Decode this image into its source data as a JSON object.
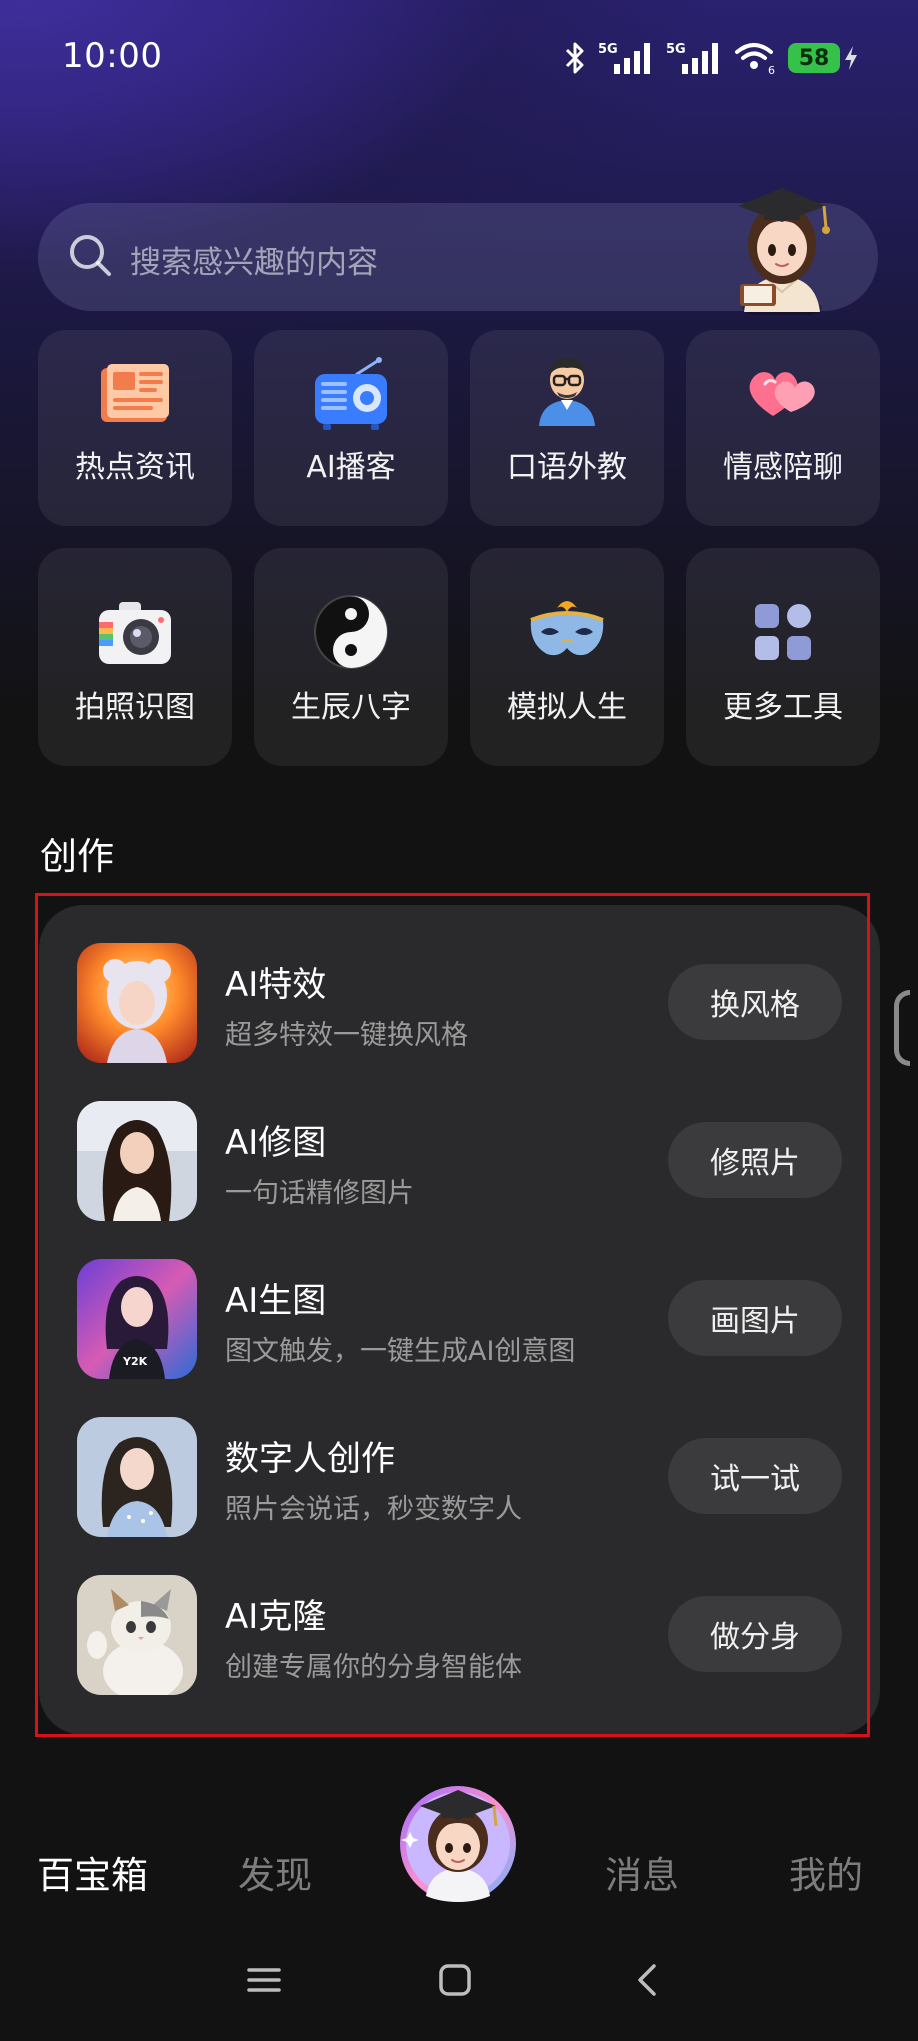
{
  "status_bar": {
    "time": "10:00",
    "network_1": "5G",
    "network_2": "5G",
    "wifi_badge": "6",
    "battery": "58"
  },
  "search": {
    "placeholder": "搜索感兴趣的内容"
  },
  "tools": [
    {
      "label": "热点资讯",
      "icon": "newspaper-icon"
    },
    {
      "label": "AI播客",
      "icon": "radio-icon"
    },
    {
      "label": "口语外教",
      "icon": "teacher-icon"
    },
    {
      "label": "情感陪聊",
      "icon": "hearts-icon"
    },
    {
      "label": "拍照识图",
      "icon": "camera-icon"
    },
    {
      "label": "生辰八字",
      "icon": "yin-yang-icon"
    },
    {
      "label": "模拟人生",
      "icon": "mask-icon"
    },
    {
      "label": "更多工具",
      "icon": "grid-icon"
    }
  ],
  "section": {
    "title": "创作"
  },
  "create_items": [
    {
      "title": "AI特效",
      "desc": "超多特效一键换风格",
      "button": "换风格"
    },
    {
      "title": "AI修图",
      "desc": "一句话精修图片",
      "button": "修照片"
    },
    {
      "title": "AI生图",
      "desc": "图文触发，一键生成AI创意图",
      "button": "画图片"
    },
    {
      "title": "数字人创作",
      "desc": "照片会说话，秒变数字人",
      "button": "试一试"
    },
    {
      "title": "AI克隆",
      "desc": "创建专属你的分身智能体",
      "button": "做分身"
    }
  ],
  "bottom_nav": {
    "items": [
      "百宝箱",
      "发现",
      "消息",
      "我的"
    ]
  },
  "colors": {
    "accent_highlight": "#d6111b",
    "battery": "#36c24a",
    "card_bg": "#2a2a2c"
  }
}
